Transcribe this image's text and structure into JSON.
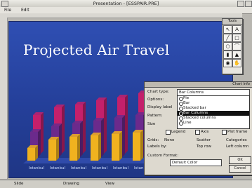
{
  "window": {
    "title": "Presentation - [ESSPAIR.PRE]"
  },
  "menu": [
    "File",
    "Edit"
  ],
  "slide": {
    "title": "Projected Air Travel"
  },
  "chart_data": {
    "type": "bar",
    "title": "",
    "xlabel": "",
    "ylabel": "",
    "categories": [
      "Istanbul",
      "Istanbul",
      "Istanbul",
      "Istanbul",
      "Istanbul",
      "Istanbul"
    ],
    "series": [
      {
        "color": "#f0b21f",
        "values": [
          18,
          30,
          34,
          36,
          38,
          40
        ]
      },
      {
        "color": "#6b2a8c",
        "values": [
          36,
          44,
          48,
          52,
          56,
          60
        ]
      },
      {
        "color": "#c4206b",
        "values": [
          55,
          66,
          70,
          76,
          80,
          86
        ]
      }
    ]
  },
  "tools": {
    "title": "Tools",
    "items": [
      "pointer",
      "text",
      "line",
      "rectangle",
      "ellipse",
      "arc",
      "chart",
      "fill"
    ]
  },
  "dialog": {
    "title": "Chart Info",
    "chart_type_label": "Chart type:",
    "chart_type_value": "Bar Columns",
    "options_label": "Options:",
    "display_label": "Display label",
    "options": [
      {
        "label": "Pie",
        "selected": false
      },
      {
        "label": "Bar",
        "selected": false
      },
      {
        "label": "Stacked bar",
        "selected": false
      },
      {
        "label": "Bar Columns",
        "selected": true
      },
      {
        "label": "Stacked columns",
        "selected": false
      },
      {
        "label": "Line",
        "selected": false
      }
    ],
    "pattern_label": "Pattern:",
    "size_label": "Size",
    "legend_label": "Legend",
    "axis_label": "Axis",
    "plot_frame_label": "Plot frame",
    "grids_label": "Grids:",
    "grids_none": "None",
    "scatter_label": "Scatter",
    "categories_label": "Categories",
    "labels_by_label": "Labels by:",
    "top_row": "Top row",
    "left_column": "Left column",
    "custom_format_label": "Custom Format:",
    "format_value": "Default  Color",
    "ok_label": "OK",
    "cancel_label": "Cancel"
  },
  "status": {
    "left": "Slide",
    "center": "Drawing",
    "right": "View"
  }
}
